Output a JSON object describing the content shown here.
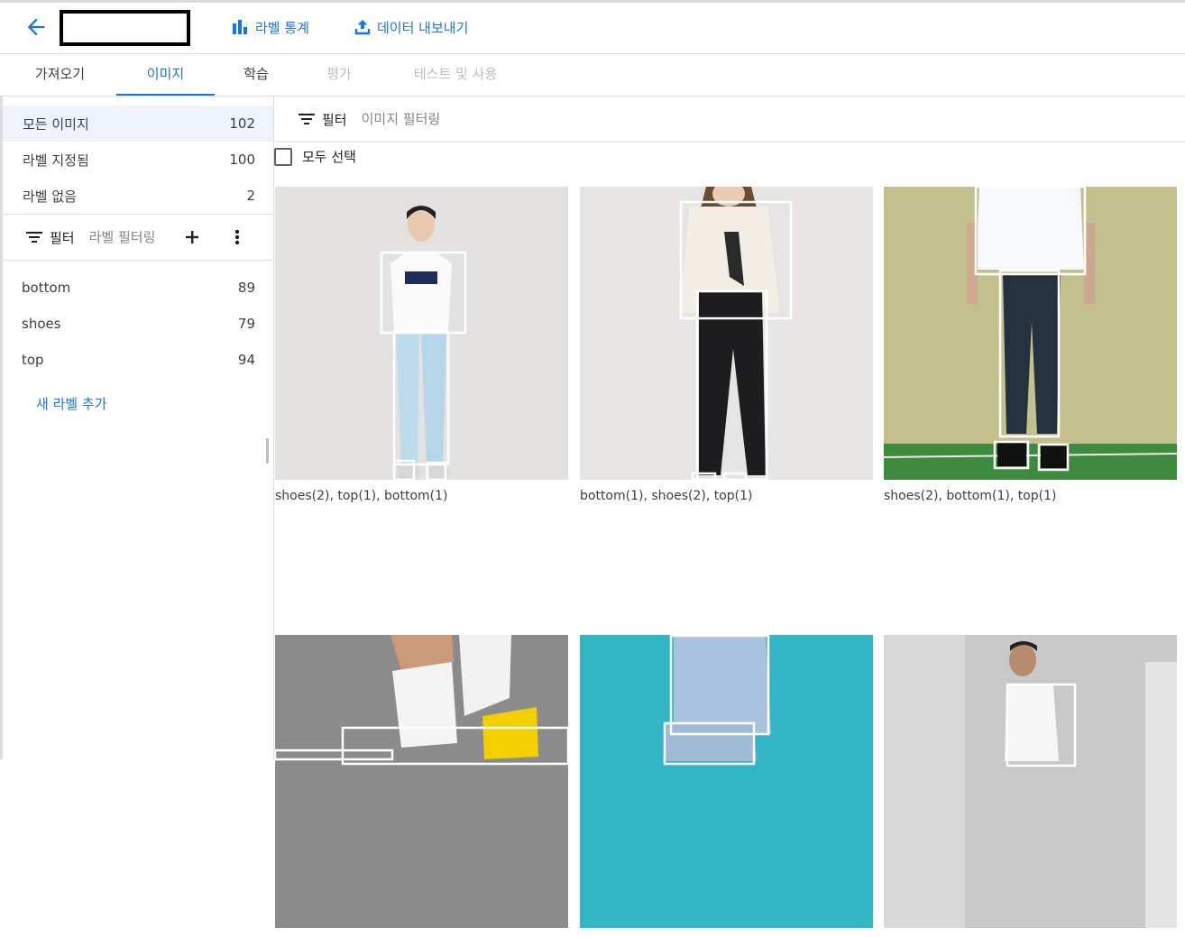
{
  "header": {
    "back_label": "back",
    "actions": [
      {
        "label": "라벨 통계",
        "icon": "bar-chart-icon"
      },
      {
        "label": "데이터 내보내기",
        "icon": "upload-icon"
      }
    ]
  },
  "tabs": [
    {
      "label": "가져오기",
      "state": "normal"
    },
    {
      "label": "이미지",
      "state": "active"
    },
    {
      "label": "학습",
      "state": "normal"
    },
    {
      "label": "평가",
      "state": "disabled"
    },
    {
      "label": "테스트 및 사용",
      "state": "disabled"
    }
  ],
  "sidebar": {
    "image_groups": [
      {
        "label": "모든 이미지",
        "count": "102",
        "selected": true
      },
      {
        "label": "라벨 지정됨",
        "count": "100",
        "selected": false
      },
      {
        "label": "라벨 없음",
        "count": "2",
        "selected": false
      }
    ],
    "filter": {
      "label": "필터",
      "placeholder": "라벨 필터링"
    },
    "labels": [
      {
        "label": "bottom",
        "count": "89"
      },
      {
        "label": "shoes",
        "count": "79"
      },
      {
        "label": "top",
        "count": "94"
      }
    ],
    "add_label": "새 라벨 추가"
  },
  "main": {
    "filter": {
      "label": "필터",
      "placeholder": "이미지 필터링"
    },
    "select_all": "모두 선택",
    "images": [
      {
        "caption": "shoes(2), top(1), bottom(1)"
      },
      {
        "caption": "bottom(1), shoes(2), top(1)"
      },
      {
        "caption": "shoes(2), bottom(1), top(1)"
      },
      {
        "caption": ""
      },
      {
        "caption": ""
      },
      {
        "caption": ""
      }
    ]
  },
  "colors": {
    "accent": "#1a73e8",
    "selected_bg": "#eef3fd",
    "divider": "#dadce0"
  }
}
